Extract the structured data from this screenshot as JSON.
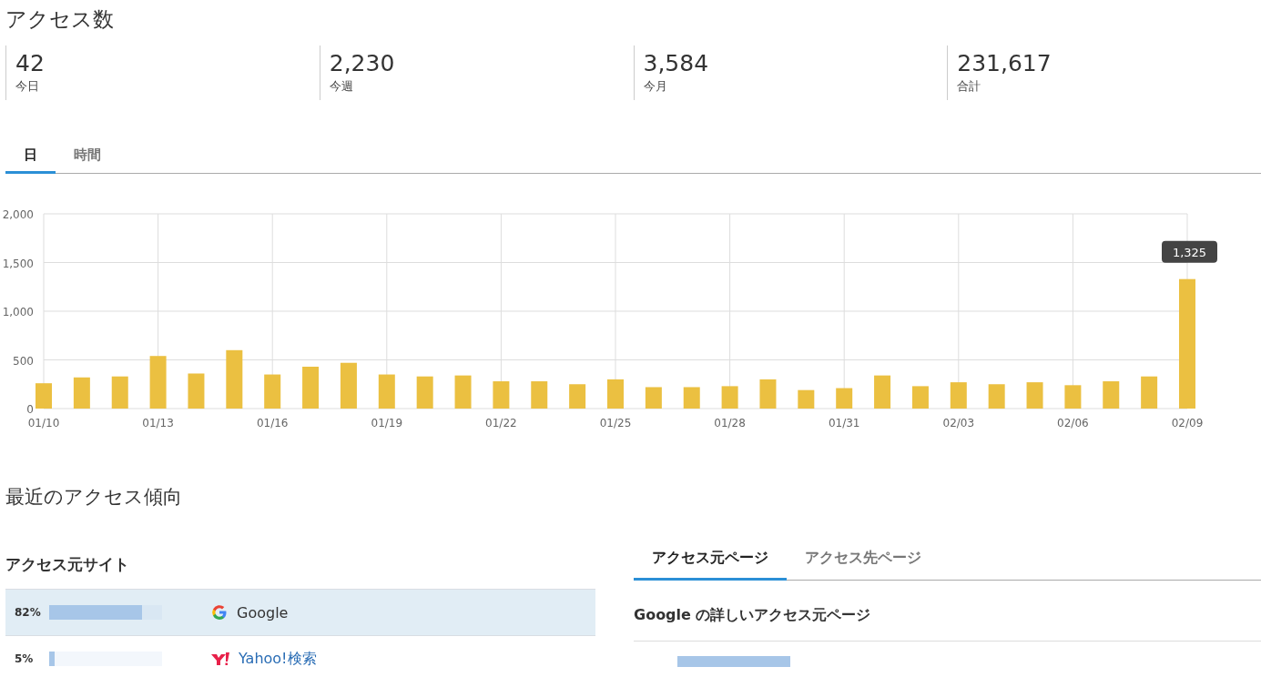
{
  "title": "アクセス数",
  "stats": [
    {
      "value": "42",
      "label": "今日"
    },
    {
      "value": "2,230",
      "label": "今週"
    },
    {
      "value": "3,584",
      "label": "今月"
    },
    {
      "value": "231,617",
      "label": "合計"
    }
  ],
  "tabs": [
    {
      "label": "日",
      "selected": true
    },
    {
      "label": "時間",
      "selected": false
    }
  ],
  "chart": {
    "chart_data": {
      "type": "bar",
      "grid": true,
      "categories": [
        "01/10",
        null,
        null,
        "01/13",
        null,
        null,
        "01/16",
        null,
        null,
        "01/19",
        null,
        null,
        "01/22",
        null,
        null,
        "01/25",
        null,
        null,
        "01/28",
        null,
        null,
        "01/31",
        null,
        null,
        "02/03",
        null,
        null,
        "02/06",
        null,
        null,
        "02/09"
      ],
      "series": [
        {
          "color": "#ebc041",
          "values": [
            260,
            320,
            330,
            540,
            360,
            600,
            350,
            430,
            470,
            350,
            330,
            340,
            280,
            280,
            250,
            300,
            220,
            220,
            230,
            300,
            190,
            210,
            340,
            230,
            270,
            250,
            270,
            240,
            280,
            330,
            1330
          ]
        }
      ],
      "ylim": [
        0,
        2000
      ],
      "yticks": [
        {
          "value": 0,
          "label": "0"
        },
        {
          "value": 500,
          "label": "500"
        },
        {
          "value": 1000,
          "label": "1,000"
        },
        {
          "value": 1500,
          "label": "1,500"
        },
        {
          "value": 2000,
          "label": "2,000"
        }
      ],
      "annotations": [
        "1,325"
      ]
    }
  },
  "trend_title": "最近のアクセス傾向",
  "sites": {
    "title": "アクセス元サイト",
    "rows": [
      {
        "percent": "82%",
        "level": 0.82,
        "name": "Google",
        "kind": "google",
        "selected": true
      },
      {
        "percent": "5%",
        "level": 0.05,
        "name": "Yahoo!検索",
        "kind": "yahoo",
        "selected": false
      }
    ]
  },
  "pages": {
    "tabs": [
      {
        "label": "アクセス元ページ",
        "selected": true
      },
      {
        "label": "アクセス先ページ",
        "selected": false
      }
    ],
    "title": "Google の詳しいアクセス元ページ"
  }
}
